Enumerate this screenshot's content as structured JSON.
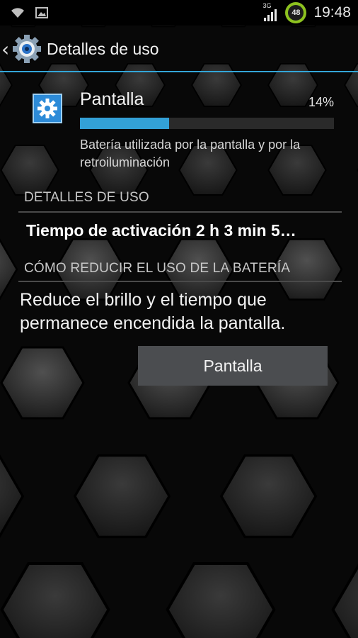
{
  "status_bar": {
    "time": "19:48",
    "battery_level": "48",
    "network_type": "3G",
    "icons": [
      "wifi-icon",
      "image-notification-icon",
      "signal-icon",
      "battery-icon"
    ]
  },
  "action_bar": {
    "title": "Detalles de uso",
    "accent_color": "#33a6d8"
  },
  "usage_item": {
    "title": "Pantalla",
    "percent_label": "14%",
    "percent_value": 14,
    "description": "Batería utilizada por la pantalla y por la retroiluminación",
    "icon": "gear-icon"
  },
  "sections": {
    "usage_details": "DETALLES DE USO",
    "reduce_usage": "CÓMO REDUCIR EL USO DE LA BATERÍA"
  },
  "usage_details_row": "Tiempo de activación 2 h 3 min 5…",
  "tip_text": "Reduce el brillo y el tiempo que permanece encendida la pantalla.",
  "buttons": {
    "screen_settings": "Pantalla"
  }
}
